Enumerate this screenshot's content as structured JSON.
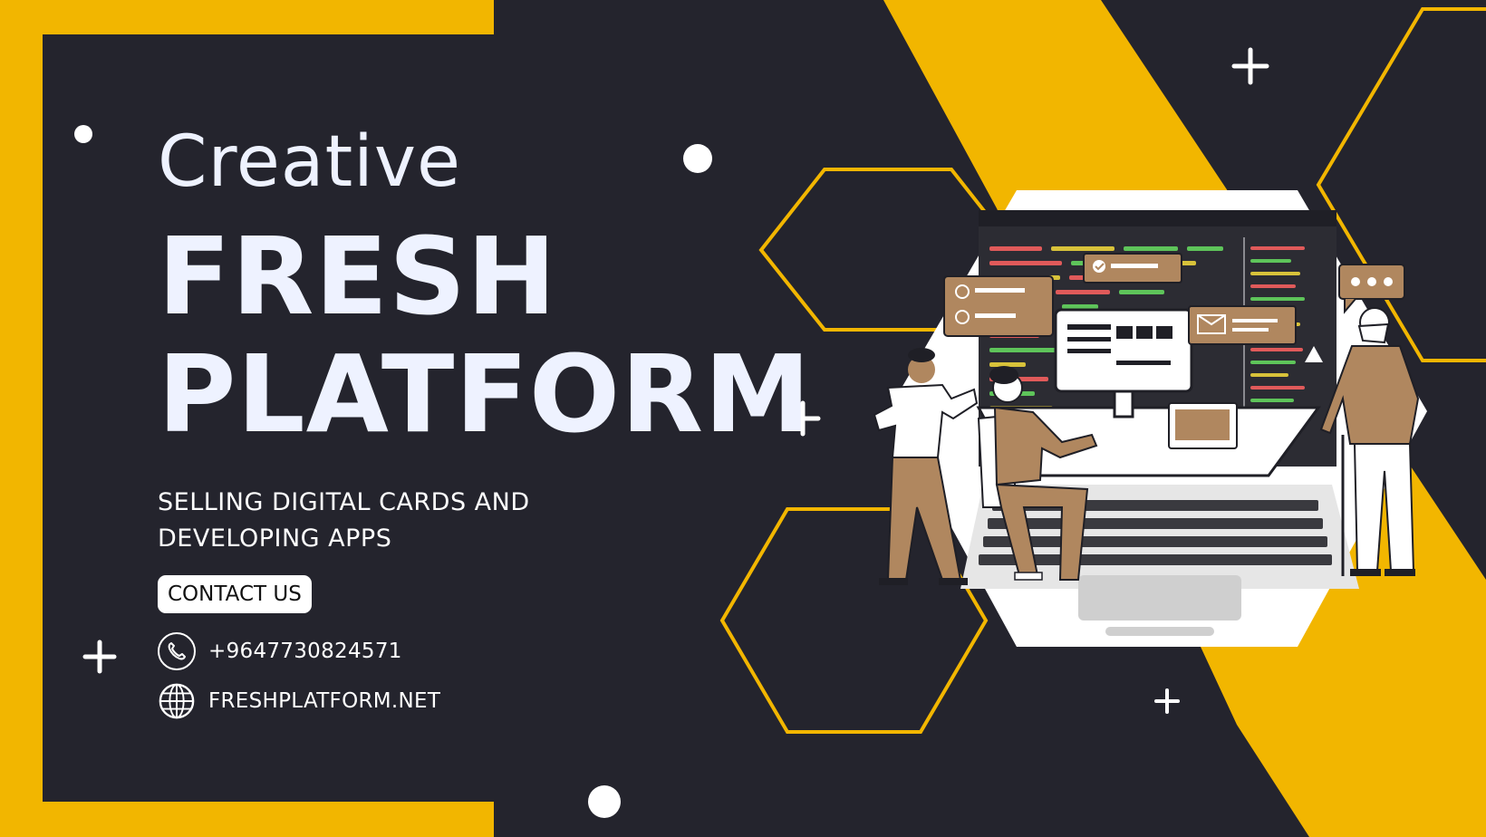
{
  "hero": {
    "kicker": "Creative",
    "title_line1": "FRESH",
    "title_line2": "PLATFORM",
    "tagline_line1": "SELLING DIGITAL CARDS AND",
    "tagline_line2": "DEVELOPING APPS"
  },
  "cta": {
    "label": "CONTACT US"
  },
  "contact": {
    "phone": "+9647730824571",
    "website": "FRESHPLATFORM.NET"
  },
  "icons": [
    "phone-icon",
    "globe-icon",
    "plus-icon",
    "check-icon",
    "mail-icon",
    "warning-icon",
    "chat-bubble-icon"
  ],
  "colors": {
    "background": "#24242d",
    "accent": "#f2b600",
    "text": "#eef2ff",
    "skin_tone": "#b0875f"
  }
}
